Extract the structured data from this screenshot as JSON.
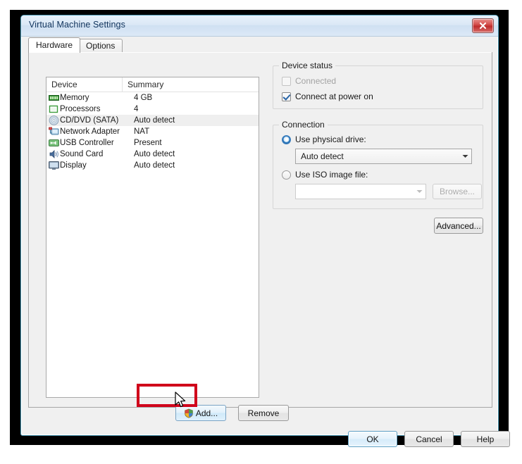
{
  "window": {
    "title": "Virtual Machine Settings",
    "close_icon": "close-icon"
  },
  "tabs": [
    {
      "label": "Hardware",
      "active": true
    },
    {
      "label": "Options",
      "active": false
    }
  ],
  "device_list": {
    "columns": [
      "Device",
      "Summary"
    ],
    "rows": [
      {
        "icon": "memory-icon",
        "device": "Memory",
        "summary": "4 GB",
        "selected": false
      },
      {
        "icon": "processor-icon",
        "device": "Processors",
        "summary": "4",
        "selected": false
      },
      {
        "icon": "cd-dvd-icon",
        "device": "CD/DVD (SATA)",
        "summary": "Auto detect",
        "selected": true
      },
      {
        "icon": "network-adapter-icon",
        "device": "Network Adapter",
        "summary": "NAT",
        "selected": false
      },
      {
        "icon": "usb-controller-icon",
        "device": "USB Controller",
        "summary": "Present",
        "selected": false
      },
      {
        "icon": "sound-card-icon",
        "device": "Sound Card",
        "summary": "Auto detect",
        "selected": false
      },
      {
        "icon": "display-icon",
        "device": "Display",
        "summary": "Auto detect",
        "selected": false
      }
    ]
  },
  "list_buttons": {
    "add_label": "Add...",
    "add_icon": "shield-icon",
    "remove_label": "Remove"
  },
  "device_status": {
    "legend": "Device status",
    "connected": {
      "label": "Connected",
      "checked": false,
      "enabled": false
    },
    "connect_at_power_on": {
      "label": "Connect at power on",
      "checked": true,
      "enabled": true
    }
  },
  "connection": {
    "legend": "Connection",
    "physical_drive": {
      "label": "Use physical drive:",
      "selected": true,
      "value": "Auto detect",
      "enabled": true
    },
    "iso_image": {
      "label": "Use ISO image file:",
      "selected": false,
      "value": "",
      "enabled": false,
      "browse_label": "Browse..."
    }
  },
  "advanced_label": "Advanced...",
  "footer": {
    "ok_label": "OK",
    "cancel_label": "Cancel",
    "help_label": "Help"
  },
  "annotation": {
    "highlight_color": "#d0021b",
    "highlight_target": "add-button"
  }
}
